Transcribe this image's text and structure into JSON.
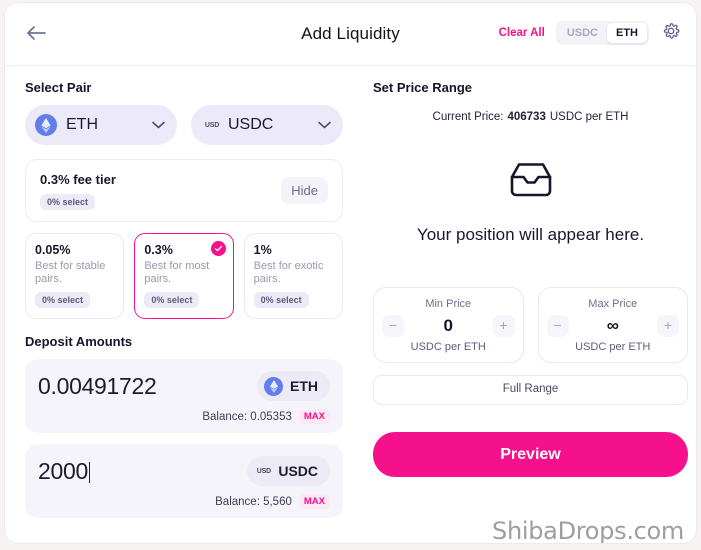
{
  "header": {
    "back_icon": "arrow-left-icon",
    "title": "Add Liquidity",
    "clear_all": "Clear All",
    "toggle": {
      "options": [
        "USDC",
        "ETH"
      ],
      "selected": "ETH"
    },
    "settings_icon": "gear-icon"
  },
  "left": {
    "select_pair_label": "Select Pair",
    "tokens": [
      {
        "symbol": "ETH",
        "icon": "ethereum-icon"
      },
      {
        "symbol": "USDC",
        "icon": "usd-coin-icon"
      }
    ],
    "fee_summary": {
      "title": "0.3% fee tier",
      "badge": "0% select",
      "hide_label": "Hide"
    },
    "fee_tiers": [
      {
        "pct": "0.05%",
        "desc": "Best for stable pairs.",
        "badge": "0% select",
        "selected": false
      },
      {
        "pct": "0.3%",
        "desc": "Best for most pairs.",
        "badge": "0% select",
        "selected": true
      },
      {
        "pct": "1%",
        "desc": "Best for exotic pairs.",
        "badge": "0% select",
        "selected": false
      }
    ],
    "deposit_label": "Deposit Amounts",
    "deposits": [
      {
        "amount": "0.00491722",
        "symbol": "ETH",
        "icon": "ethereum-icon",
        "balance": "Balance: 0.05353",
        "max": "MAX",
        "focused": false
      },
      {
        "amount": "2000",
        "symbol": "USDC",
        "icon": "usd-coin-icon",
        "balance": "Balance: 5,560",
        "max": "MAX",
        "focused": true
      }
    ]
  },
  "right": {
    "set_price_range_label": "Set Price Range",
    "current_price": {
      "label": "Current Price:",
      "value": "406733",
      "unit": "USDC per ETH"
    },
    "empty_state": {
      "icon": "inbox-icon",
      "text": "Your position will appear here."
    },
    "ranges": [
      {
        "title": "Min Price",
        "value": "0",
        "unit": "USDC per ETH",
        "minus": "−",
        "plus": "+"
      },
      {
        "title": "Max Price",
        "value": "∞",
        "unit": "USDC per ETH",
        "minus": "−",
        "plus": "+"
      }
    ],
    "full_range_label": "Full Range",
    "preview_label": "Preview"
  },
  "watermark": "ShibaDrops.com",
  "colors": {
    "accent_pink": "#f5118b",
    "eth_blue": "#627eea",
    "panel_bg": "#f5f4fa"
  }
}
